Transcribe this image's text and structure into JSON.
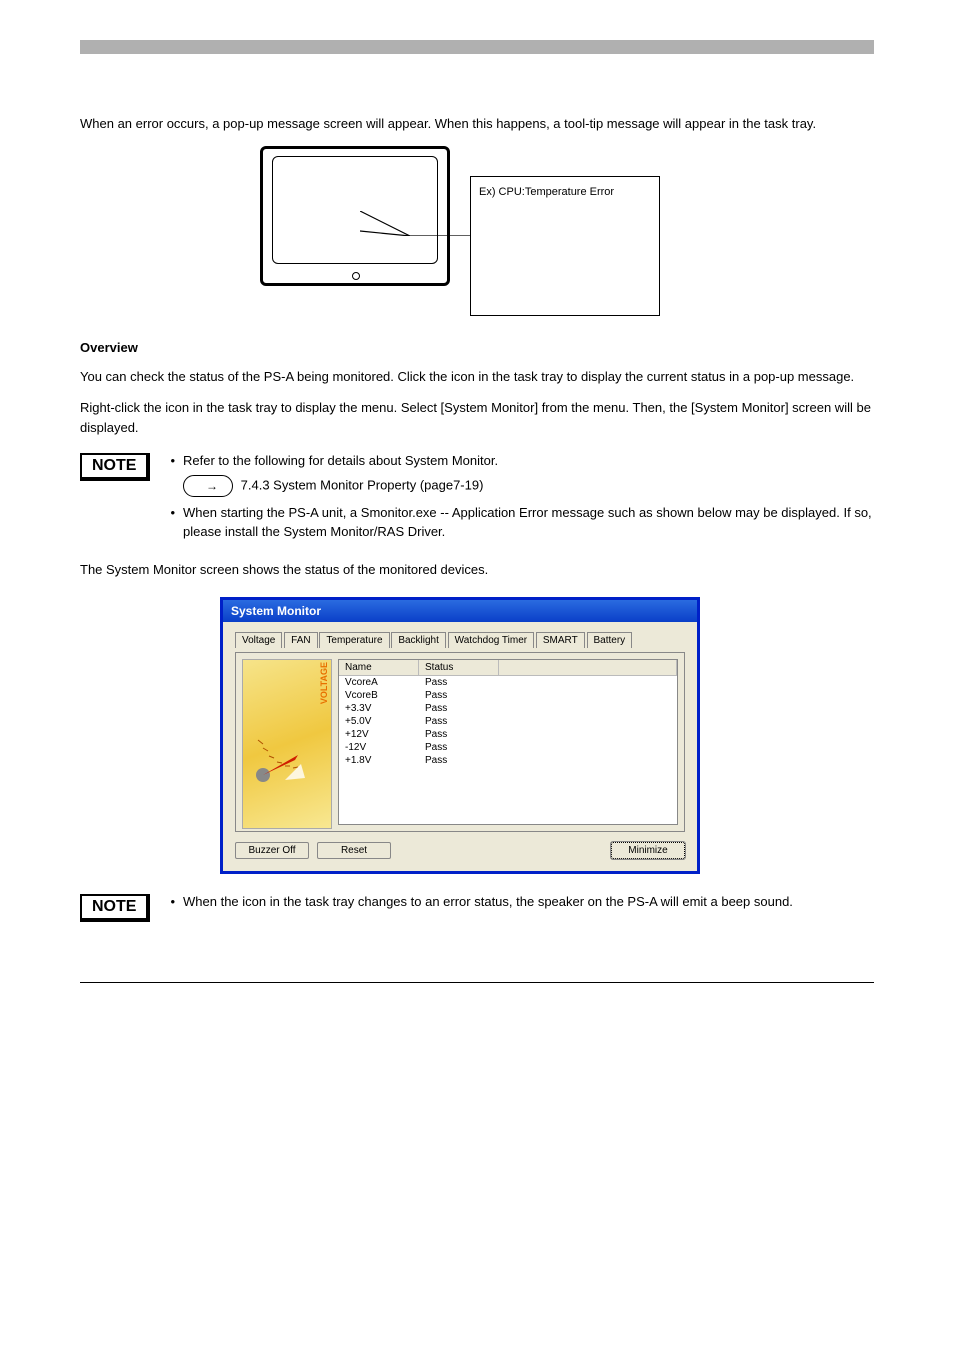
{
  "intro": "When an error occurs, a pop-up message screen will appear. When this happens, a tool-tip message will appear in the task tray.",
  "sections": {
    "overview_title": "Overview",
    "overview_para1": "You can check the status of the PS-A being monitored. Click the icon in the task tray to display the current status in a pop-up message.",
    "overview_para2": "Right-click the icon in the task tray to display the menu. Select [System Monitor] from the menu. Then, the [System Monitor] screen will be displayed.",
    "overview_para3": "The System Monitor screen shows the status of the monitored devices."
  },
  "callout": "Ex) CPU:Temperature Error",
  "notes": {
    "label": "NOTE",
    "note1_line1": "Refer to the following for details about System Monitor.",
    "note1_line2a": "When starting the PS-A unit, a Smonitor.exe -- Application Error message such as shown below may be displayed.",
    "note1_line2b": "If so, please install the System Monitor/RAS Driver.",
    "note1_link": "7.4.3 System Monitor Property (page7-19)",
    "note2_line": "When the icon in the task tray changes to an error status, the speaker on the PS-A will emit a beep sound."
  },
  "window": {
    "title": "System Monitor",
    "tabs": [
      "Voltage",
      "FAN",
      "Temperature",
      "Backlight",
      "Watchdog Timer",
      "SMART",
      "Battery"
    ],
    "active_tab": 0,
    "gauge_label": "VOLTAGE",
    "columns": {
      "name": "Name",
      "status": "Status"
    },
    "rows": [
      {
        "name": "VcoreA",
        "status": "Pass"
      },
      {
        "name": "VcoreB",
        "status": "Pass"
      },
      {
        "name": "+3.3V",
        "status": "Pass"
      },
      {
        "name": "+5.0V",
        "status": "Pass"
      },
      {
        "name": "+12V",
        "status": "Pass"
      },
      {
        "name": "-12V",
        "status": "Pass"
      },
      {
        "name": "+1.8V",
        "status": "Pass"
      }
    ],
    "buttons": {
      "buzzer": "Buzzer Off",
      "reset": "Reset",
      "minimize": "Minimize"
    }
  },
  "footer": {
    "left": "",
    "right": ""
  }
}
